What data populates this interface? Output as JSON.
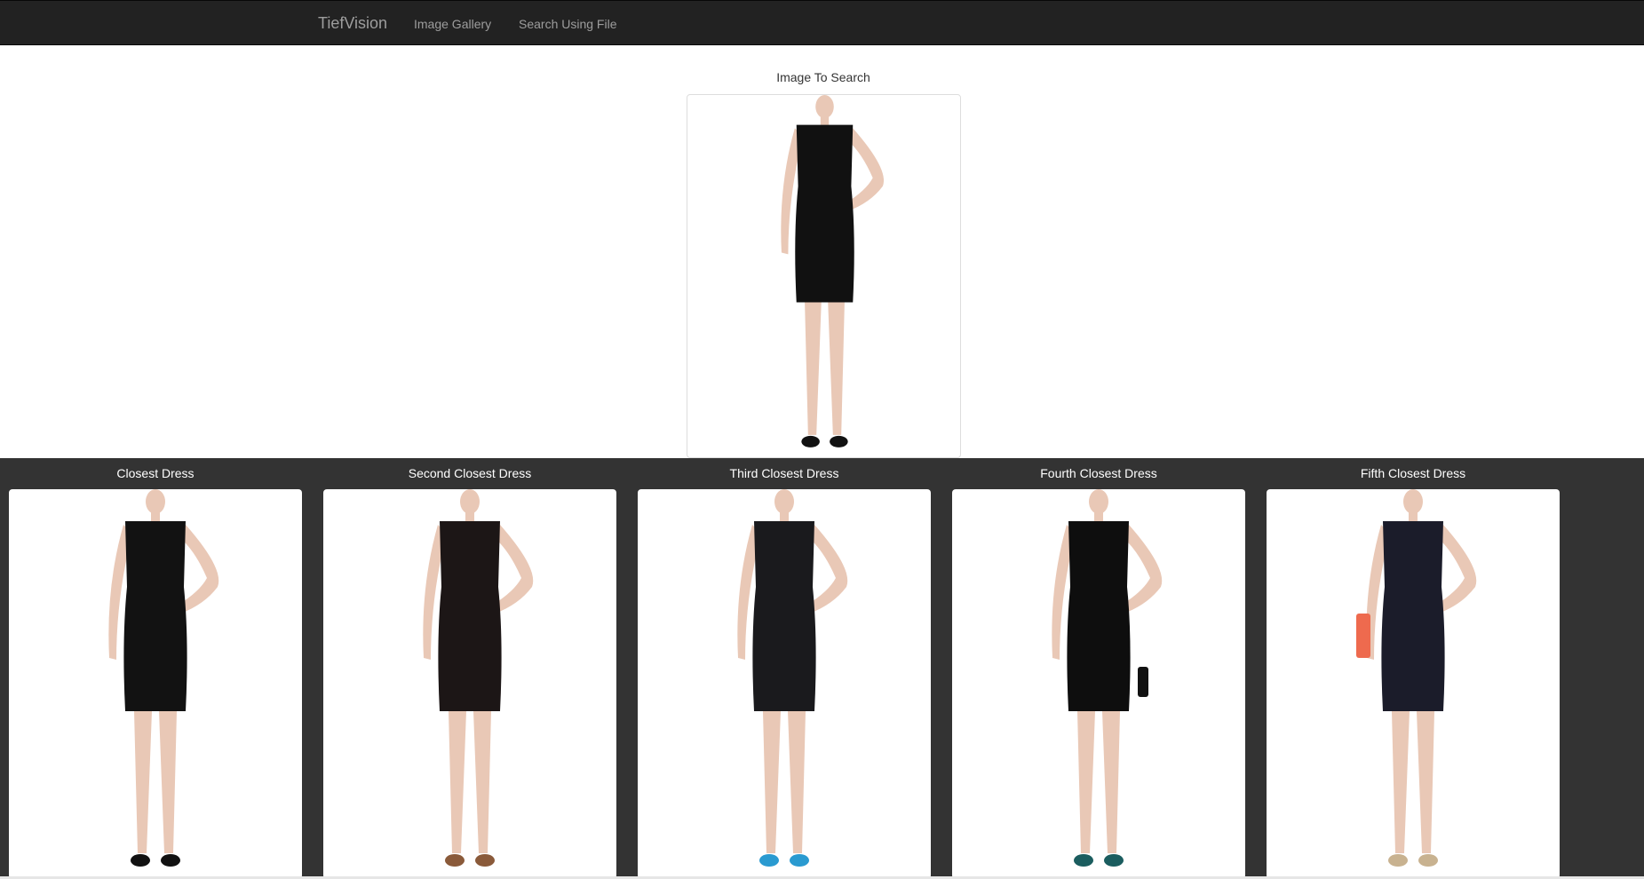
{
  "navbar": {
    "brand": "TiefVision",
    "links": [
      "Image Gallery",
      "Search Using File"
    ]
  },
  "query": {
    "label": "Image To Search",
    "dress_color": "#111111",
    "shoe_color": "#111111"
  },
  "results": [
    {
      "label": "Closest Dress",
      "dress_color": "#121212",
      "shoe_color": "#111111",
      "accessory": "none"
    },
    {
      "label": "Second Closest Dress",
      "dress_color": "#1c1616",
      "shoe_color": "#8a5a3a",
      "accessory": "none"
    },
    {
      "label": "Third Closest Dress",
      "dress_color": "#1a1a1d",
      "shoe_color": "#2a9ad0",
      "accessory": "none"
    },
    {
      "label": "Fourth Closest Dress",
      "dress_color": "#0e0e0e",
      "shoe_color": "#1b5d5f",
      "accessory": "clutch"
    },
    {
      "label": "Fifth Closest Dress",
      "dress_color": "#1b1c2a",
      "shoe_color": "#c8b290",
      "accessory": "orange-clutch"
    }
  ],
  "colors": {
    "navbar_bg": "#222222",
    "nav_text": "#9d9d9d",
    "results_bg": "#333333",
    "skin": "#e9c8b6"
  }
}
